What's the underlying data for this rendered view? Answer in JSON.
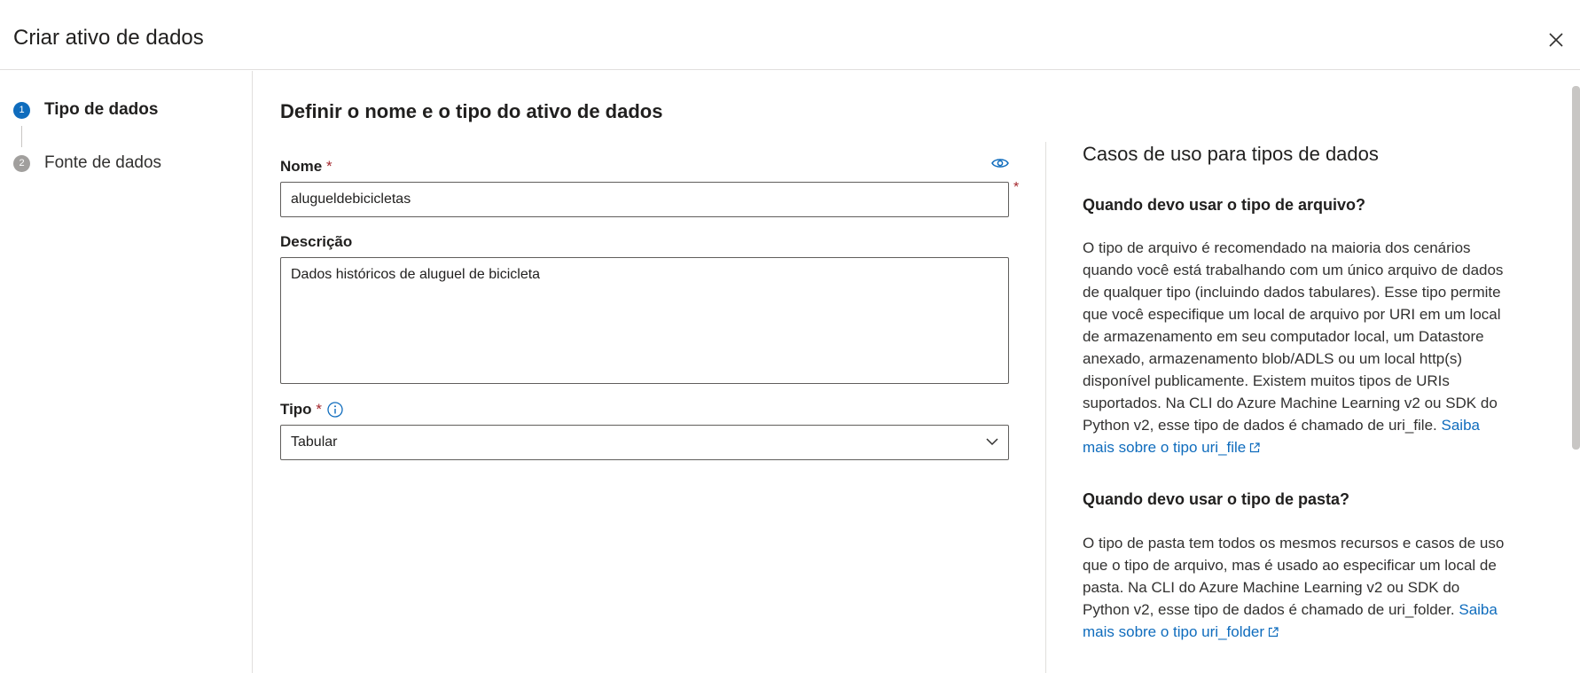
{
  "dialog": {
    "title": "Criar ativo de dados"
  },
  "steps": [
    {
      "number": "1",
      "label": "Tipo de dados",
      "active": true
    },
    {
      "number": "2",
      "label": "Fonte de dados",
      "active": false
    }
  ],
  "form": {
    "heading": "Definir o nome e o tipo do ativo de dados",
    "name": {
      "label": "Nome",
      "required_mark": "*",
      "value": "alugueldebicicletas"
    },
    "description": {
      "label": "Descrição",
      "value": "Dados históricos de aluguel de bicicleta"
    },
    "type": {
      "label": "Tipo",
      "required_mark": "*",
      "selected": "Tabular"
    }
  },
  "side": {
    "title": "Casos de uso para tipos de dados",
    "sections": [
      {
        "question": "Quando devo usar o tipo de arquivo?",
        "text": "O tipo de arquivo é recomendado na maioria dos cenários quando você está trabalhando com um único arquivo de dados de qualquer tipo (incluindo dados tabulares). Esse tipo permite que você especifique um local de arquivo por URI em um local de armazenamento em seu computador local, um Datastore anexado, armazenamento blob/ADLS ou um local http(s) disponível publicamente. Existem muitos tipos de URIs suportados. Na CLI do Azure Machine Learning v2 ou SDK do Python v2, esse tipo de dados é chamado de uri_file.",
        "link": "Saiba mais sobre o tipo uri_file"
      },
      {
        "question": "Quando devo usar o tipo de pasta?",
        "text": "O tipo de pasta tem todos os mesmos recursos e casos de uso que o tipo de arquivo, mas é usado ao especificar um local de pasta. Na CLI do Azure Machine Learning v2 ou SDK do Python v2, esse tipo de dados é chamado de uri_folder.",
        "link": "Saiba mais sobre o tipo uri_folder"
      }
    ]
  },
  "colors": {
    "accent": "#0f6cbd",
    "required": "#a4262c",
    "border": "#605e5c"
  }
}
